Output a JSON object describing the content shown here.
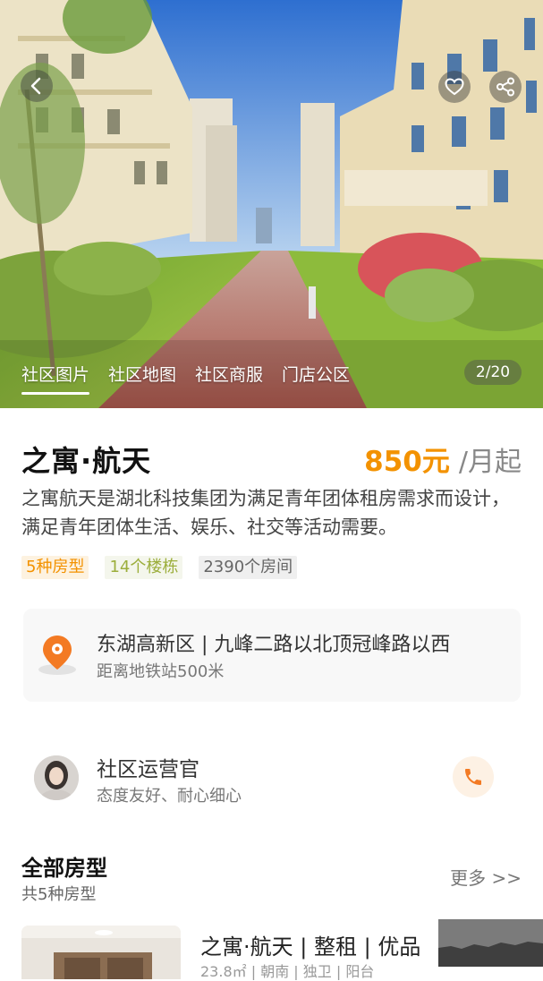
{
  "hero": {
    "tabs": [
      "社区图片",
      "社区地图",
      "社区商服",
      "门店公区"
    ],
    "active_tab": 0,
    "counter": "2/20",
    "icons": {
      "back": "chevron-left-icon",
      "favorite": "heart-icon",
      "share": "share-icon"
    }
  },
  "info": {
    "title": "之寓·航天",
    "price_amount": "850元",
    "price_unit": "/月起",
    "description": "之寓航天是湖北科技集团为满足青年团体租房需求而设计，满足青年团体生活、娱乐、社交等活动需要。",
    "tags": [
      "5种房型",
      "14个楼栋",
      "2390个房间"
    ]
  },
  "location": {
    "address": "东湖高新区 | 九峰二路以北顶冠峰路以西",
    "subway": "距离地铁站500米",
    "icon": "location-pin-icon"
  },
  "manager": {
    "title": "社区运营官",
    "subtitle": "态度友好、耐心细心",
    "icon": "phone-icon"
  },
  "rooms": {
    "section_title": "全部房型",
    "count_text": "共5种房型",
    "more": "更多 >>",
    "first_title": "之寓·航天 | 整租 | 优品",
    "first_sub": "23.8㎡ | 朝南 | 独卫 | 阳台"
  },
  "colors": {
    "accent": "#f39200",
    "tag_orange_bg": "#fdf2e0",
    "tag_green": "#9cae3c"
  }
}
